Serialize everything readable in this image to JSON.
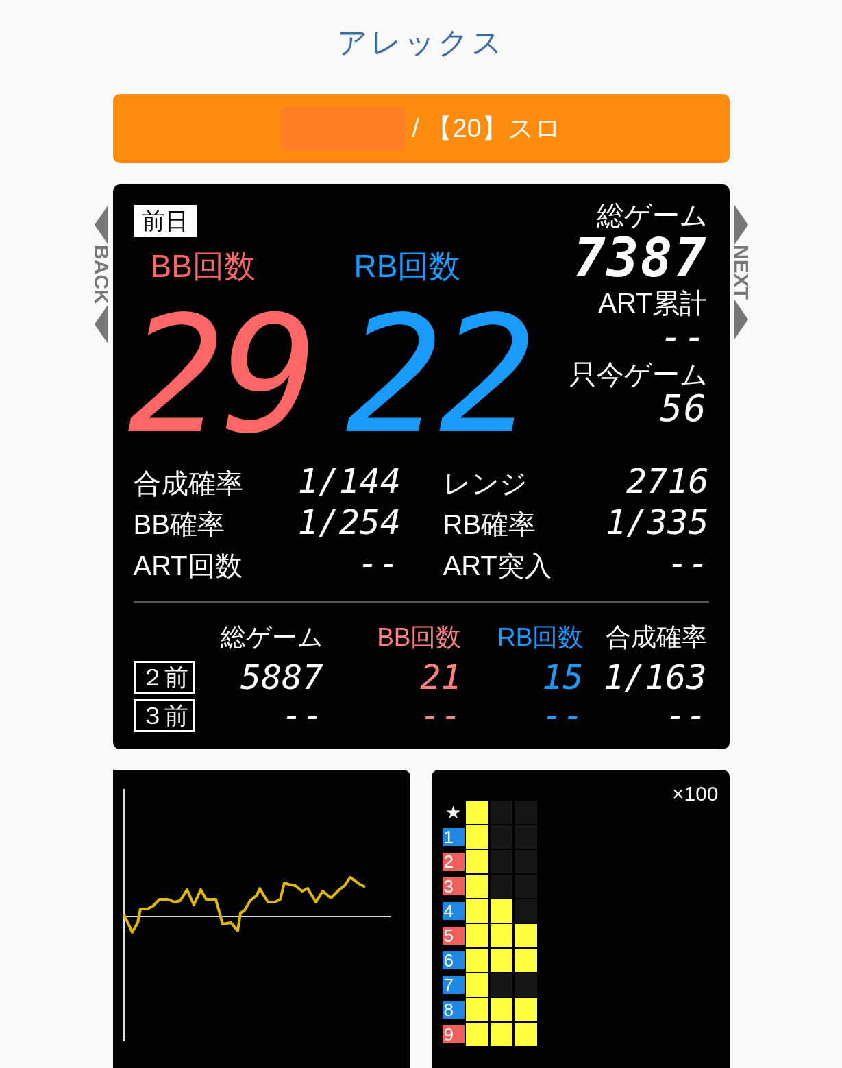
{
  "title": "アレックス",
  "machine_bar": {
    "text": "/ 【20】スロ"
  },
  "nav": {
    "back": "BACK",
    "next": "NEXT"
  },
  "today": {
    "day_tab": "前日",
    "bb_label": "BB回数",
    "rb_label": "RB回数",
    "bb_count": "29",
    "rb_count": "22",
    "side": [
      {
        "label": "総ゲーム",
        "value": "7387"
      },
      {
        "label": "ART累計",
        "value": "--"
      },
      {
        "label": "只今ゲーム",
        "value": "56"
      }
    ],
    "stats": [
      {
        "label": "合成確率",
        "value": "1/144"
      },
      {
        "label": "レンジ",
        "value": "2716"
      },
      {
        "label": "BB確率",
        "value": "1/254"
      },
      {
        "label": "RB確率",
        "value": "1/335"
      },
      {
        "label": "ART回数",
        "value": "--"
      },
      {
        "label": "ART突入",
        "value": "--"
      }
    ]
  },
  "history": {
    "columns": [
      {
        "label": "総ゲーム",
        "color": "#ffffff"
      },
      {
        "label": "BB回数",
        "color": "#ff8080"
      },
      {
        "label": "RB回数",
        "color": "#1a9bff"
      },
      {
        "label": "合成確率",
        "color": "#ffffff"
      }
    ],
    "rows": [
      {
        "day": "２前",
        "cells": [
          "5887",
          "21",
          "15",
          "1/163"
        ]
      },
      {
        "day": "３前",
        "cells": [
          "--",
          "--",
          "--",
          "--"
        ]
      }
    ]
  },
  "histogram": {
    "unit": "×100",
    "rows": [
      {
        "label": "★",
        "kind": "plain",
        "stars": 1
      },
      {
        "label": "1",
        "kind": "badge",
        "color": "#1e88e5",
        "stars": 1
      },
      {
        "label": "2",
        "kind": "badge",
        "color": "#f0605d",
        "stars": 1
      },
      {
        "label": "3",
        "kind": "badge",
        "color": "#f0605d",
        "stars": 1
      },
      {
        "label": "4",
        "kind": "badge",
        "color": "#1e88e5",
        "stars": 2
      },
      {
        "label": "5",
        "kind": "badge",
        "color": "#f0605d",
        "stars": 3
      },
      {
        "label": "6",
        "kind": "badge",
        "color": "#1e88e5",
        "stars": 3
      },
      {
        "label": "7",
        "kind": "badge",
        "color": "#1e88e5",
        "stars": 1
      },
      {
        "label": "8",
        "kind": "badge",
        "color": "#1e88e5",
        "stars": 3
      },
      {
        "label": "9",
        "kind": "badge",
        "color": "#f0605d",
        "stars": 3
      }
    ]
  }
}
